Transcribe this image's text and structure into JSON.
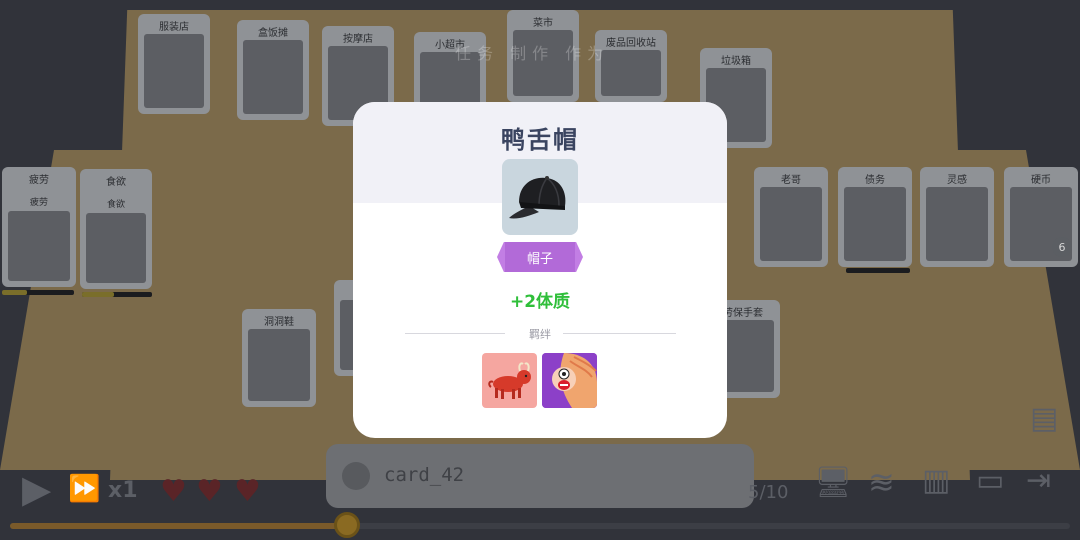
{
  "background": {
    "location_cards": [
      {
        "label": "服装店"
      },
      {
        "label": "盒饭摊"
      },
      {
        "label": "按摩店"
      },
      {
        "label": "小超市"
      },
      {
        "label": "菜市"
      },
      {
        "label": "废品回收站"
      },
      {
        "label": "垃圾箱"
      }
    ],
    "hint_text": "任务 制作 作为",
    "left_cards": [
      {
        "label": "疲劳",
        "sub": "疲劳",
        "meter_fill": 0.35
      },
      {
        "label": "食欲",
        "sub": "食欲",
        "meter_fill": 0.45
      }
    ],
    "right_cards": [
      {
        "label": "老哥"
      },
      {
        "label": "债务",
        "meter_fill": 0.0
      },
      {
        "label": "灵感"
      },
      {
        "label": "硬币",
        "badge": "6"
      }
    ],
    "table_cards": [
      {
        "label": "洞洞鞋"
      },
      {
        "label": "劳保手套"
      }
    ]
  },
  "hud": {
    "speed_label": "x1",
    "hearts": 3,
    "chat_name": "card_42",
    "deck_count": "5/10",
    "progress": 0.32
  },
  "modal": {
    "title": "鸭舌帽",
    "item_icon": "baseball-cap-icon",
    "tag": "帽子",
    "effect": "+2体质",
    "bond_label": "羁绊",
    "bonds": [
      {
        "icon": "bull-icon"
      },
      {
        "icon": "screaming-face-icon"
      }
    ]
  },
  "colors": {
    "title": "#3a4460",
    "tag": "#b26ad8",
    "effect": "#2fbf3a",
    "overlay": "#2d2f36"
  }
}
